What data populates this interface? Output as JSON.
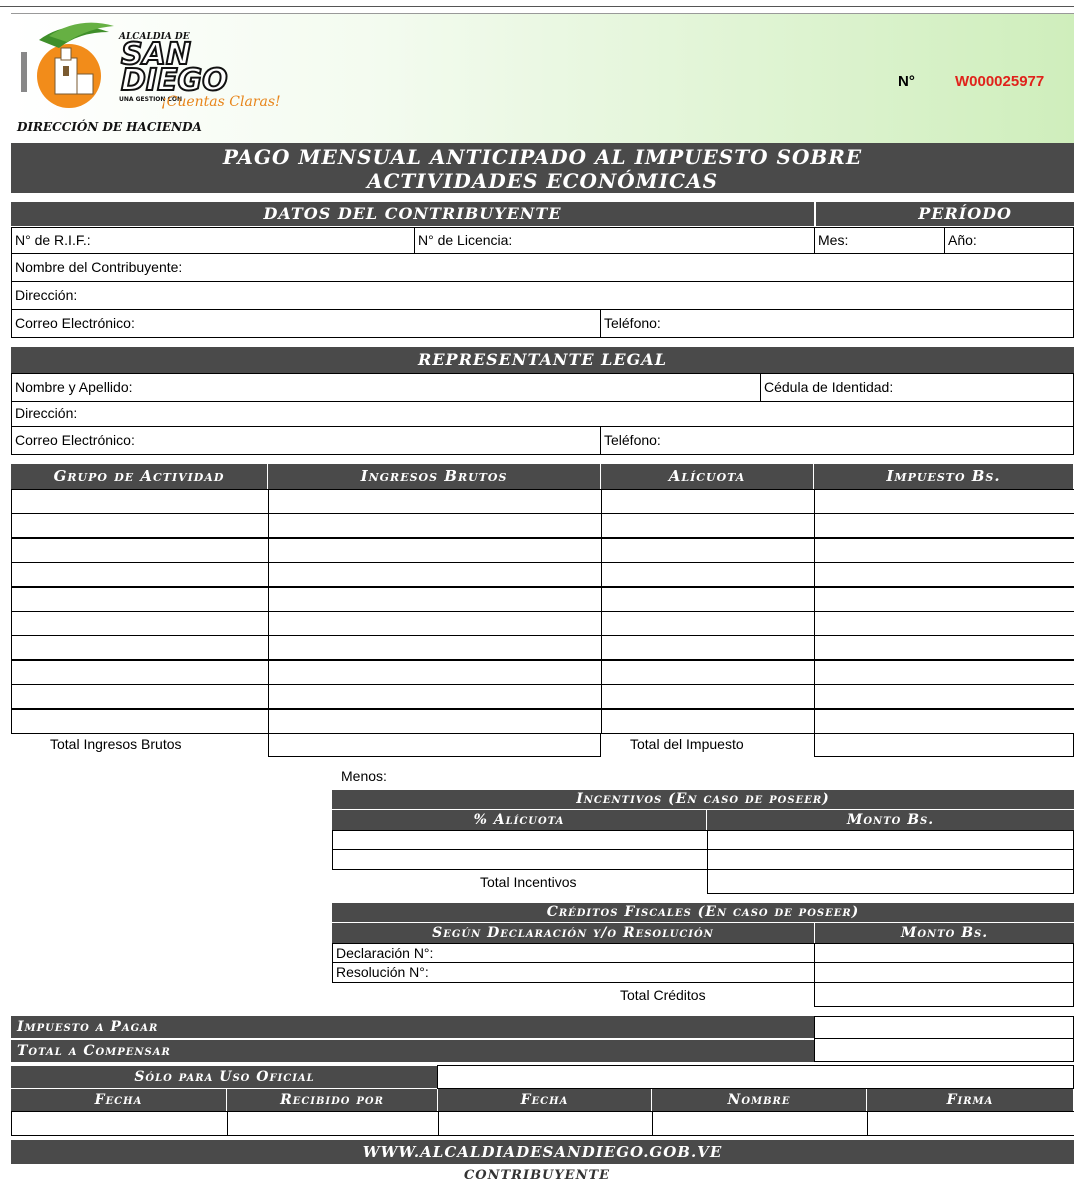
{
  "header": {
    "logo_text_top": "ALCALDIA DE",
    "logo_text_san": "SAN",
    "logo_text_diego": "DIEGO",
    "logo_text_gestion": "UNA GESTION CON",
    "logo_text_slogan": "¡Cuentas Claras!",
    "department": "DIRECCIÓN DE HACIENDA",
    "number_label": "N°",
    "number_value": "W000025977"
  },
  "title": {
    "line1": "PAGO MENSUAL ANTICIPADO AL IMPUESTO SOBRE",
    "line2": "ACTIVIDADES ECONÓMICAS"
  },
  "taxpayer": {
    "section_title": "DATOS DEL CONTRIBUYENTE",
    "period_title": "PERÍODO",
    "rif_label": "N° de R.I.F.:",
    "license_label": "N° de Licencia:",
    "month_label": "Mes:",
    "year_label": "Año:",
    "name_label": "Nombre del Contribuyente:",
    "address_label": "Dirección:",
    "email_label": "Correo Electrónico:",
    "phone_label": "Teléfono:"
  },
  "legal_rep": {
    "section_title": "REPRESENTANTE LEGAL",
    "name_label": "Nombre y Apellido:",
    "id_label": "Cédula de Identidad:",
    "address_label": "Dirección:",
    "email_label": "Correo Electrónico:",
    "phone_label": "Teléfono:"
  },
  "activities": {
    "headers": [
      "Grupo de Actividad",
      "Ingresos Brutos",
      "Alícuota",
      "Impuesto Bs."
    ],
    "total_gross_label": "Total Ingresos Brutos",
    "total_tax_label": "Total del Impuesto"
  },
  "deductions": {
    "less_label": "Menos:",
    "incentives_title": "Incentivos (En caso de poseer)",
    "incentives_col1": "% Alícuota",
    "incentives_col2": "Monto Bs.",
    "total_incentives_label": "Total Incentivos",
    "credits_title": "Créditos Fiscales (En caso de poseer)",
    "credits_col1": "Según Declaración y/o Resolución",
    "credits_col2": "Monto Bs.",
    "declaration_label": "Declaración N°:",
    "resolution_label": "Resolución N°:",
    "total_credits_label": "Total Créditos"
  },
  "summary": {
    "tax_to_pay_label": "Impuesto a Pagar",
    "total_compensate_label": "Total a Compensar",
    "official_use_label": "Sólo para Uso Oficial",
    "official_headers": [
      "Fecha",
      "Recibido por",
      "Fecha",
      "Nombre",
      "Firma"
    ],
    "website": "WWW.ALCALDIADESANDIEGO.GOB.VE",
    "copy_label": "CONTRIBUYENTE"
  },
  "colors": {
    "header_gradient_start": "#ffffff",
    "header_gradient_end": "#cfeebc",
    "number_red": "#e0221b",
    "bar_gray": "#4a4a4a"
  }
}
